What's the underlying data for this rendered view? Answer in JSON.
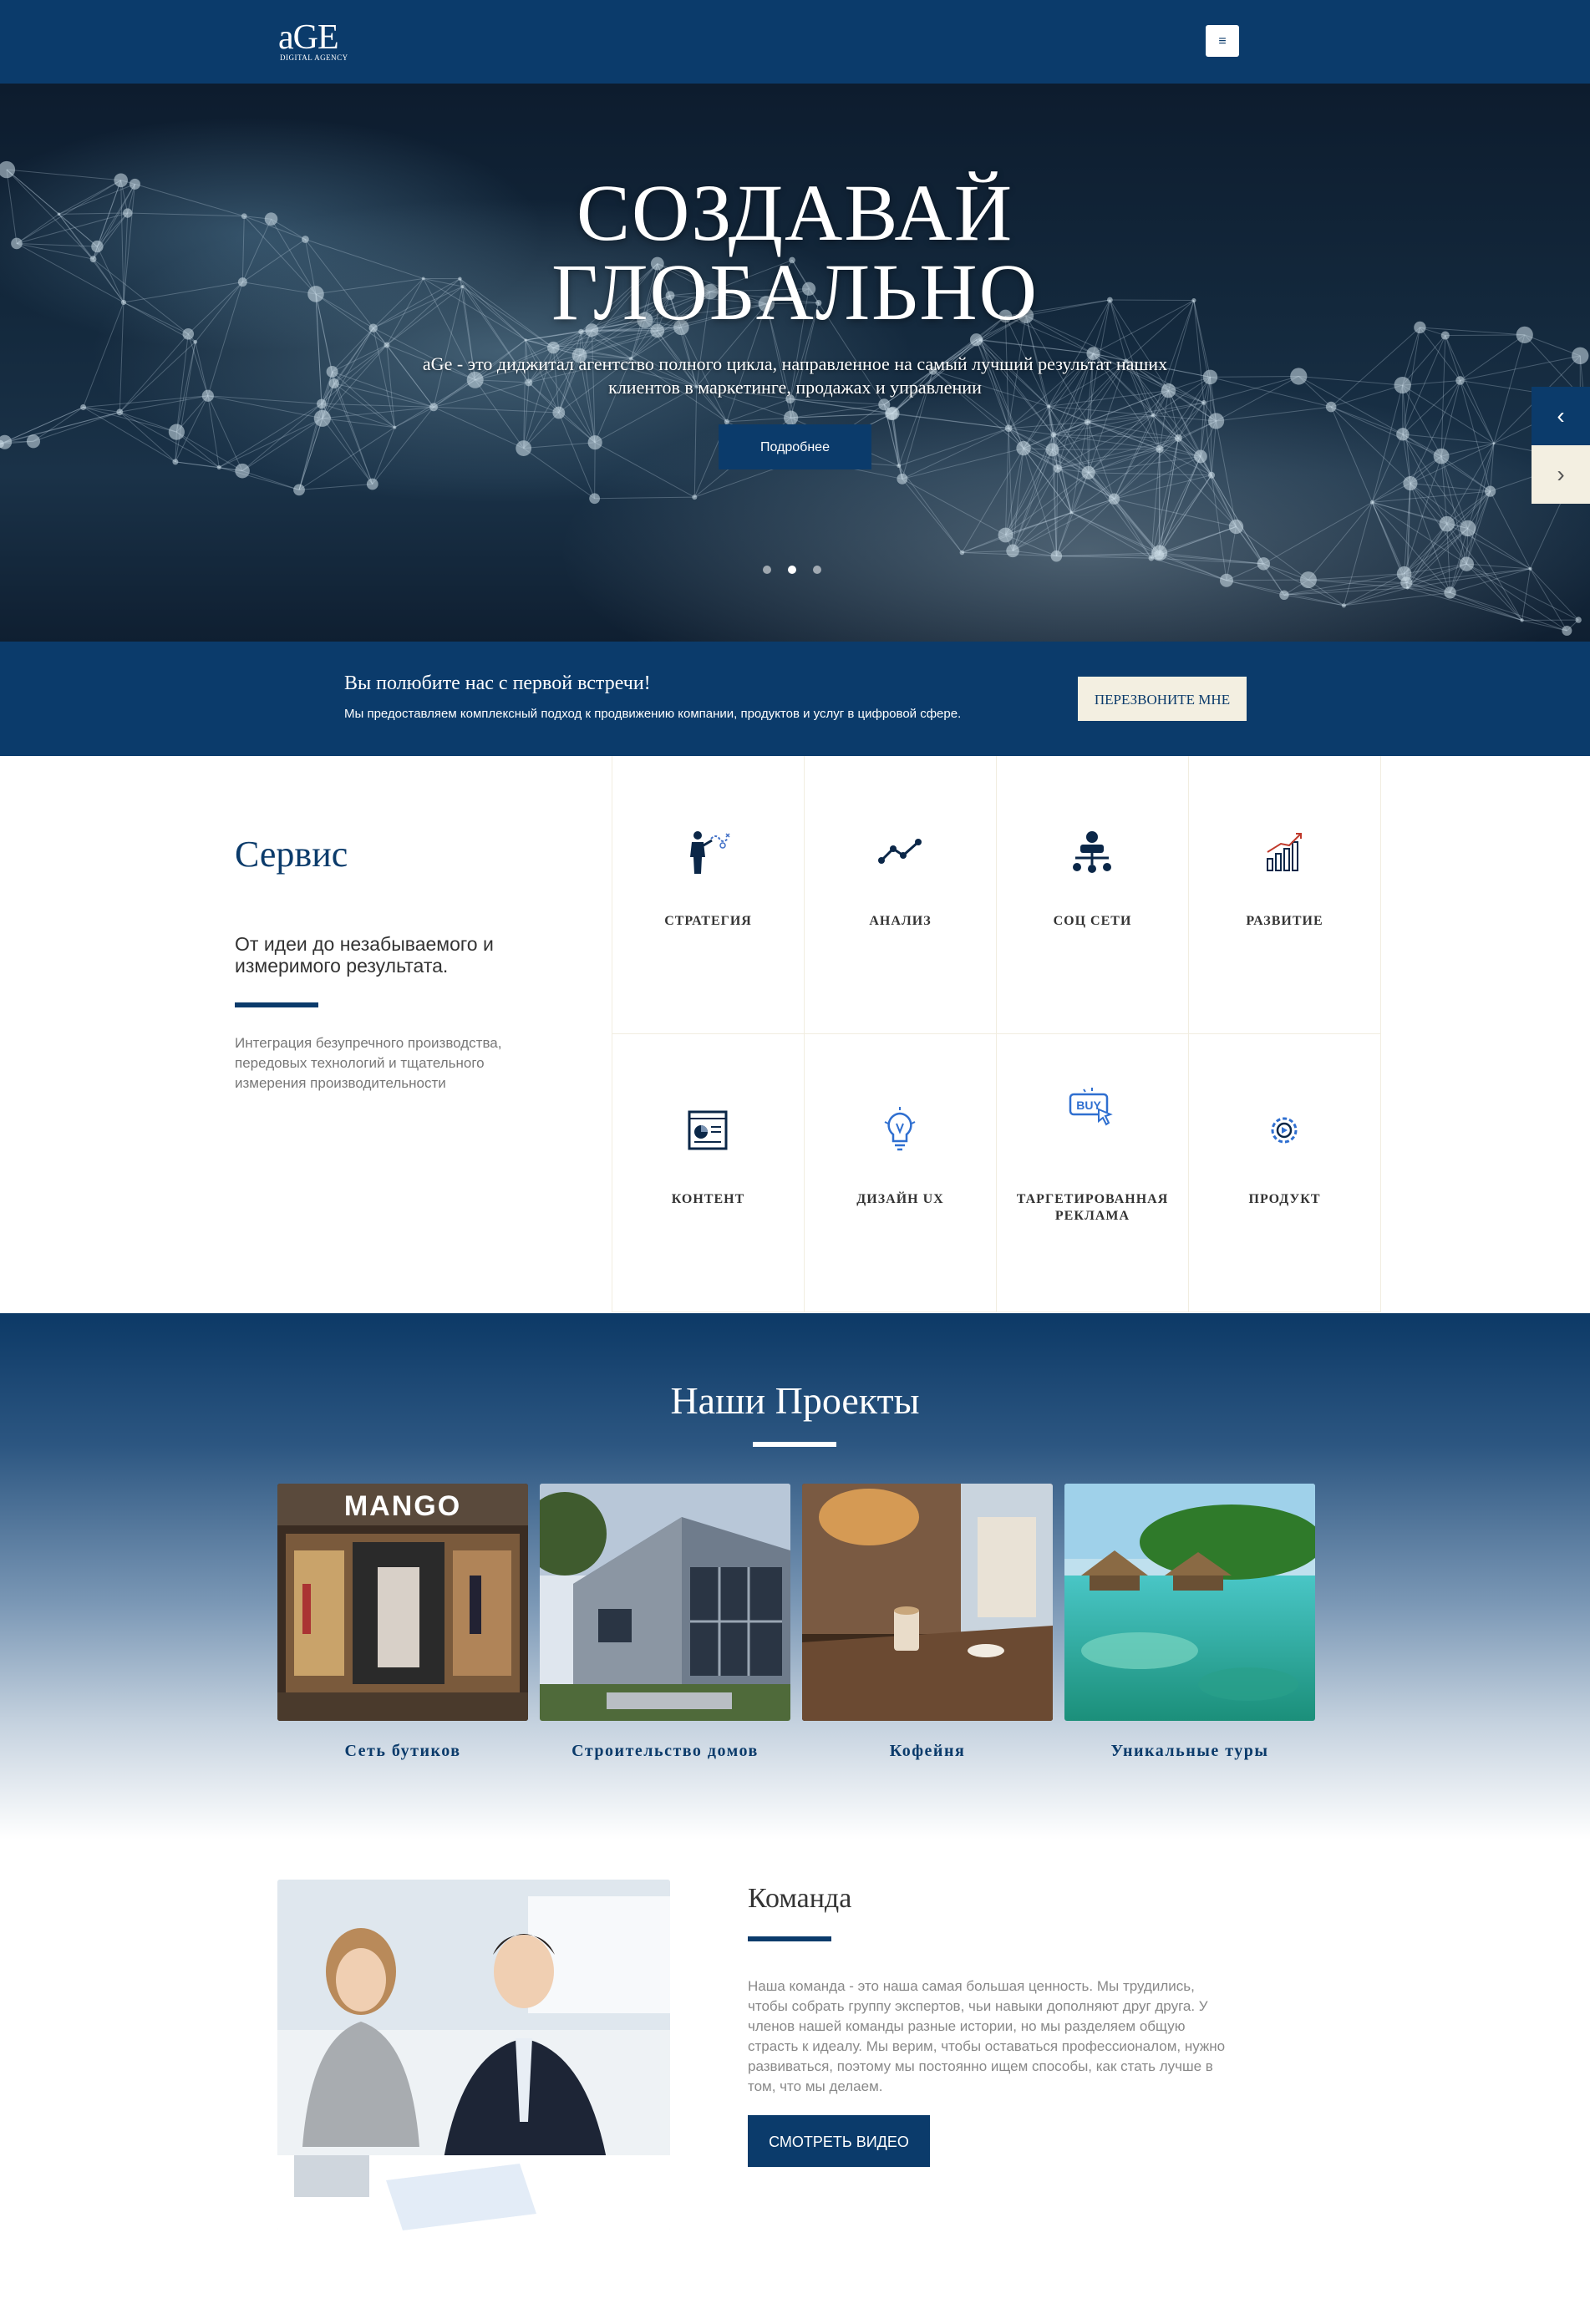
{
  "header": {
    "logo_main": "aGE",
    "logo_sub": "DIGITAL AGENCY",
    "menu_icon": "hamburger-icon",
    "menu_glyph": "≡"
  },
  "hero": {
    "title_line1": "СОЗДАВАЙ",
    "title_line2": "ГЛОБАЛЬНО",
    "subtitle": "aGe - это диджитал агентство полного цикла, направленное на самый лучший результат наших клиентов в маркетинге, продажах и управлении",
    "button_label": "Подробнее",
    "slides_total": 3,
    "active_slide": 2,
    "prev_glyph": "‹",
    "next_glyph": "›"
  },
  "cta": {
    "title": "Вы полюбите нас с первой встречи!",
    "text": "Мы предоставляем комплексный подход к продвижению компании, продуктов и услуг в цифровой сфере.",
    "button_label": "ПЕРЕЗВОНИТЕ МНЕ"
  },
  "services": {
    "title": "Сервис",
    "lead": "От идеи до незабываемого и измеримого результата.",
    "description": "Интеграция безупречного производства, передовых технологий и тщательного измерения производительности",
    "items": [
      {
        "label": "СТРАТЕГИЯ",
        "icon": "strategy-icon"
      },
      {
        "label": "АНАЛИЗ",
        "icon": "analytics-icon"
      },
      {
        "label": "СОЦ СЕТИ",
        "icon": "social-network-icon"
      },
      {
        "label": "РАЗВИТИЕ",
        "icon": "growth-chart-icon"
      },
      {
        "label": "КОНТЕНТ",
        "icon": "content-icon"
      },
      {
        "label": "ДИЗАЙН UX",
        "icon": "lightbulb-design-icon"
      },
      {
        "label": "ТАРГЕТИРОВАННАЯ РЕКЛАМА",
        "icon": "buy-click-icon"
      },
      {
        "label": "ПРОДУКТ",
        "icon": "product-gear-icon"
      }
    ]
  },
  "projects": {
    "title": "Наши Проекты",
    "items": [
      {
        "label": "Сеть бутиков",
        "image_text": "MANGO"
      },
      {
        "label": "Строительство домов"
      },
      {
        "label": "Кофейня"
      },
      {
        "label": "Уникальные туры"
      }
    ]
  },
  "team": {
    "title": "Команда",
    "text": "Наша команда - это наша самая большая ценность. Мы трудились, чтобы собрать группу экспертов, чьи навыки дополняют друг друга. У членов нашей команды разные истории, но мы разделяем общую страсть к идеалу. Мы верим, чтобы оставаться профессионалом, нужно развиваться, поэтому мы постоянно ищем способы, как стать лучше в том, что мы делаем.",
    "button_label": "СМОТРЕТЬ ВИДЕО"
  },
  "colors": {
    "brand": "#0b3b6b",
    "cream": "#f3efe1"
  }
}
